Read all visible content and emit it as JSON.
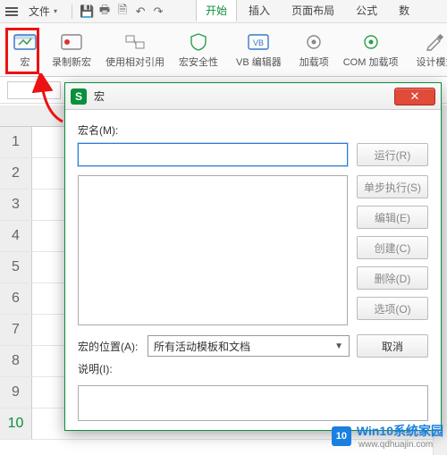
{
  "menubar": {
    "file_label": "文件"
  },
  "tabs": [
    "开始",
    "插入",
    "页面布局",
    "公式",
    "数"
  ],
  "ribbon": {
    "macro": "宏",
    "record": "录制新宏",
    "relative": "使用相对引用",
    "security": "宏安全性",
    "vbe": "VB 编辑器",
    "addins": "加载项",
    "com": "COM 加载项",
    "design": "设计模式"
  },
  "dialog": {
    "title": "宏",
    "name_label": "宏名(M):",
    "buttons": {
      "run": "运行(R)",
      "step": "单步执行(S)",
      "edit": "编辑(E)",
      "create": "创建(C)",
      "delete": "删除(D)",
      "options": "选项(O)",
      "cancel": "取消"
    },
    "location_label": "宏的位置(A):",
    "location_value": "所有活动模板和文档",
    "desc_label": "说明(I):"
  },
  "rows": [
    "1",
    "2",
    "3",
    "4",
    "5",
    "6",
    "7",
    "8",
    "9",
    "10"
  ],
  "watermark": {
    "badge": "10",
    "line1": "Win10系统家园",
    "line2": "www.qdhuajin.com"
  }
}
